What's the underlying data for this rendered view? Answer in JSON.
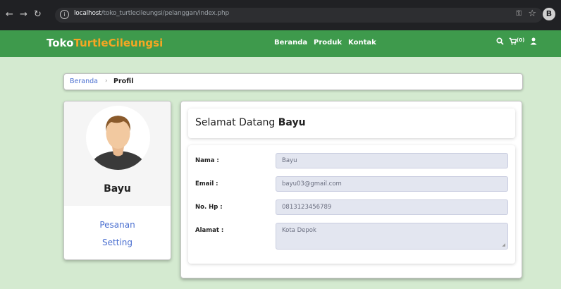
{
  "browser": {
    "url_host": "localhost",
    "url_path": "/toko_turtlecileungsi/pelanggan/index.php"
  },
  "navbar": {
    "brand_part1": "Toko",
    "brand_part2": "TurtleCileungsi",
    "menu": [
      "Beranda",
      "Produk",
      "Kontak"
    ],
    "cart_count": "(0)"
  },
  "breadcrumb": {
    "home": "Beranda",
    "separator": "›",
    "current": "Profil"
  },
  "profile": {
    "name": "Bayu",
    "links": [
      "Pesanan",
      "Setting"
    ]
  },
  "welcome": {
    "prefix": "Selamat Datang",
    "name": "Bayu"
  },
  "form": {
    "fields": [
      {
        "label": "Nama :",
        "value": "Bayu"
      },
      {
        "label": "Email :",
        "value": "bayu03@gmail.com"
      },
      {
        "label": "No. Hp :",
        "value": "0813123456789"
      },
      {
        "label": "Alamat :",
        "value": "Kota Depok"
      }
    ]
  },
  "colors": {
    "navbar": "#3e9a4c",
    "brand_accent": "#f5a623",
    "background": "#d4ead0",
    "link": "#4a6fd0"
  },
  "icons": [
    "back-icon",
    "forward-icon",
    "reload-icon",
    "info-icon",
    "key-icon",
    "star-icon",
    "search-icon",
    "cart-icon",
    "user-icon",
    "avatar-icon"
  ]
}
